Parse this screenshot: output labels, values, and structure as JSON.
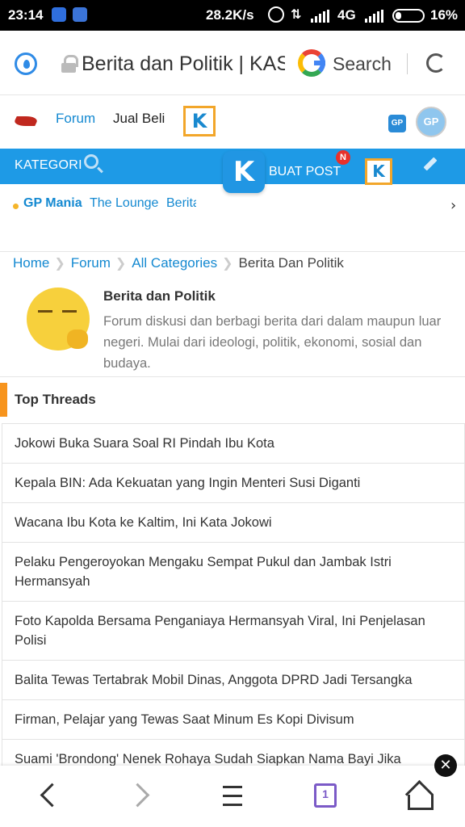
{
  "status_bar": {
    "time": "23:14",
    "net_speed": "28.2K/s",
    "network_type": "4G",
    "battery": "16%"
  },
  "browser": {
    "page_title": "Berita dan Politik | KASKUS",
    "search_label": "Search"
  },
  "site_header": {
    "nav_forum": "Forum",
    "nav_jual_beli": "Jual Beli",
    "k_logo": "K",
    "gp_badge": "GP",
    "avatar_text": "GP"
  },
  "category_bar": {
    "kategori_label": "KATEGORI",
    "buat_post_label": "BUAT POST",
    "new_badge": "N",
    "k_logo": "K"
  },
  "sub_nav": {
    "items": [
      "GP Mania",
      "The Lounge",
      "Berita"
    ],
    "more_arrow": "›"
  },
  "breadcrumb": {
    "items": [
      "Home",
      "Forum",
      "All Categories"
    ],
    "current": "Berita Dan Politik"
  },
  "forum": {
    "name": "Berita dan Politik",
    "description": "Forum diskusi dan berbagi berita dari dalam maupun luar negeri. Mulai dari ideologi, politik, ekonomi, sosial dan budaya."
  },
  "top_threads": {
    "title": "Top Threads",
    "items": [
      "Jokowi Buka Suara Soal RI Pindah Ibu Kota",
      "Kepala BIN: Ada Kekuatan yang Ingin Menteri Susi Diganti",
      "Wacana Ibu Kota ke Kaltim, Ini Kata Jokowi",
      "Pelaku Pengeroyokan Mengaku Sempat Pukul dan Jambak Istri Hermansyah",
      "Foto Kapolda Bersama Penganiaya Hermansyah Viral, Ini Penjelasan Polisi",
      "Balita Tewas Tertabrak Mobil Dinas, Anggota DPRD Jadi Tersangka",
      "Firman, Pelajar yang Tewas Saat Minum Es Kopi Divisum",
      "Suami 'Brondong' Nenek Rohaya Sudah Siapkan Nama Bayi Jika"
    ]
  },
  "close_button": "✕",
  "bottom_nav": {
    "tab_count": "1"
  },
  "colors": {
    "primary_blue": "#1e9ae6",
    "link_blue": "#1489d1",
    "accent_orange": "#f7941d",
    "badge_red": "#e8312b",
    "tabs_purple": "#7b5ac7"
  }
}
